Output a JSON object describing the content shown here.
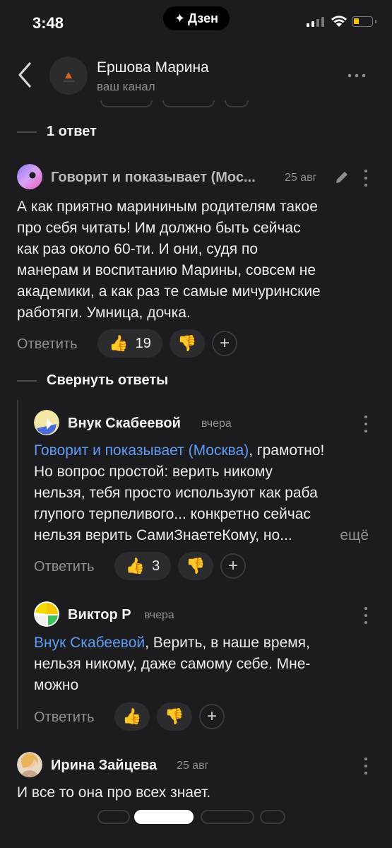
{
  "status_bar": {
    "time": "3:48",
    "app_pill": "Дзен"
  },
  "header": {
    "channel_name": "Ершова Марина",
    "channel_subtitle": "ваш канал"
  },
  "thread": {
    "replies_count_label": "1 ответ",
    "collapse_label": "Свернуть ответы"
  },
  "comments": [
    {
      "author": "Говорит и показывает (Мос...",
      "date": "25 авг",
      "lines": [
        "А как приятно марининым родителям такое",
        "про себя читать! Им должно быть сейчас",
        "как раз около 60-ти. И они, судя по",
        "манерам и воспитанию Марины, совсем не",
        "академики, а как раз те самые мичуринские",
        "работяги. Умница, дочка."
      ],
      "reply_label": "Ответить",
      "likes": "19"
    },
    {
      "author": "Внук Скабеевой",
      "date": "вчера",
      "mention": "Говорит и показывает (Москва)",
      "first_line_rest": ", грамотно!",
      "lines": [
        "Но вопрос простой: верить никому",
        "нельзя, тебя просто используют как раба",
        "глупого терпеливого... конкретно сейчас",
        "нельзя верить СамиЗнаетеКому, но..."
      ],
      "more_label": "ещё",
      "reply_label": "Ответить",
      "likes": "3"
    },
    {
      "author": "Виктор Р",
      "date": "вчера",
      "mention": "Внук Скабеевой",
      "first_line_rest": ", Верить, в наше время,",
      "lines": [
        "нельзя никому, даже самому себе. Мне-",
        "можно"
      ],
      "reply_label": "Ответить"
    },
    {
      "author": "Ирина Зайцева",
      "date": "25 авг",
      "lines": [
        "И все то она про всех знает."
      ]
    }
  ],
  "icons": {
    "back": "chevron-left-icon",
    "more": "more-horizontal-icon",
    "kebab": "more-vertical-icon",
    "edit": "pencil-icon",
    "like": "thumbs-up-icon",
    "dislike": "thumbs-down-icon",
    "add_reaction": "plus-icon"
  },
  "colors": {
    "background": "#1c1c1e",
    "mention": "#5b9cf4",
    "reaction_bg": "#2c2c2e",
    "battery": "#f5c400"
  }
}
